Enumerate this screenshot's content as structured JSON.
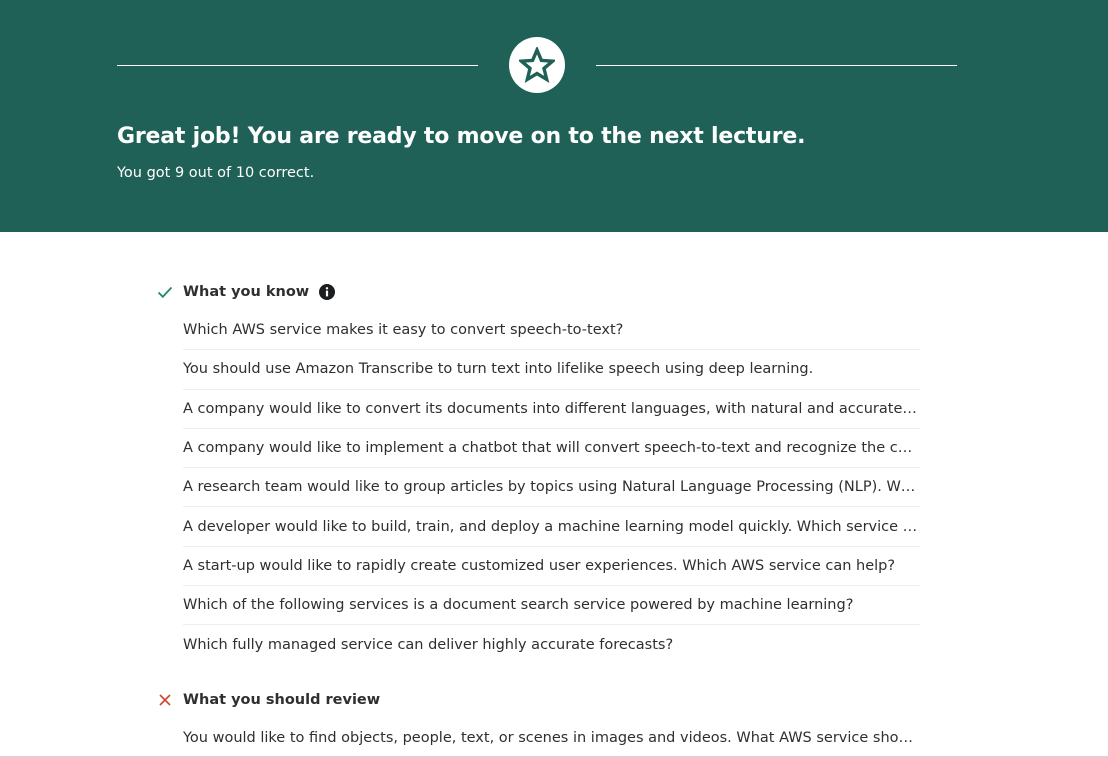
{
  "banner": {
    "title": "Great job! You are ready to move on to the next lecture.",
    "subtitle": "You got 9 out of 10 correct.",
    "background_color": "#1f6157",
    "badge_icon": "star-icon"
  },
  "know_section": {
    "label": "What you know",
    "status_icon": "check-icon",
    "status_color": "#1e8a6e",
    "info_icon": "info-icon",
    "questions": [
      "Which AWS service makes it easy to convert speech-to-text?",
      "You should use Amazon Transcribe to turn text into lifelike speech using deep learning.",
      "A company would like to convert its documents into different languages, with natural and accurate w…",
      "A company would like to implement a chatbot that will convert speech-to-text and recognize the cust…",
      "A research team would like to group articles by topics using Natural Language Processing (NLP). Whi…",
      "A developer would like to build, train, and deploy a machine learning model quickly. Which service can…",
      "A start-up would like to rapidly create customized user experiences. Which AWS service can help?",
      "Which of the following services is a document search service powered by machine learning?",
      "Which fully managed service can deliver highly accurate forecasts?"
    ]
  },
  "review_section": {
    "label": "What you should review",
    "status_icon": "x-icon",
    "status_color": "#d0442b",
    "questions": [
      "You would like to find objects, people, text, or scenes in images and videos. What AWS service should…"
    ]
  }
}
